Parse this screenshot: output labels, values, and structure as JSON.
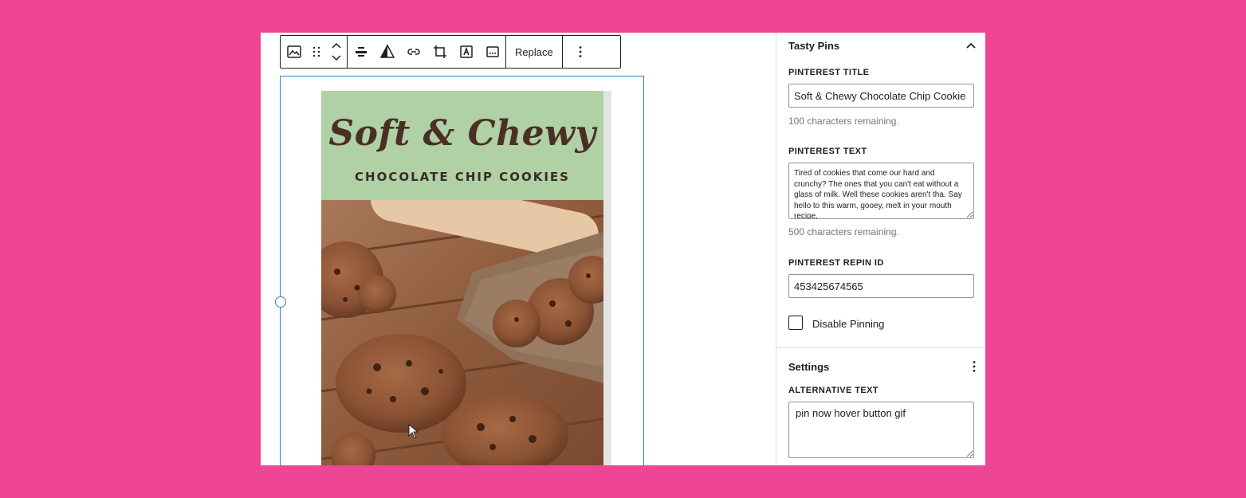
{
  "toolbar": {
    "replace_label": "Replace",
    "icons": [
      "image-icon",
      "drag-handle-icon",
      "move-up-icon",
      "move-down-icon",
      "align-icon",
      "duotone-icon",
      "link-icon",
      "crop-icon",
      "text-overlay-icon",
      "caption-icon",
      "more-options-icon"
    ]
  },
  "image": {
    "title_script": "Soft & Chewy",
    "subtitle": "CHOCOLATE CHIP COOKIES"
  },
  "sidebar": {
    "tasty_pins": {
      "heading": "Tasty Pins",
      "pinterest_title_label": "PINTEREST TITLE",
      "pinterest_title_value": "Soft & Chewy Chocolate Chip Cookie Recipe",
      "pinterest_title_help": "100 characters remaining.",
      "pinterest_text_label": "PINTEREST TEXT",
      "pinterest_text_value": "Tired of cookies that come our hard and crunchy? The ones that you can't eat without a glass of milk. Well these cookies aren't tha. Say hello to this warm, gooey, melt in your mouth recipe.",
      "pinterest_text_help": "500 characters remaining.",
      "repin_id_label": "PINTEREST REPIN ID",
      "repin_id_value": "453425674565",
      "disable_pinning_label": "Disable Pinning"
    },
    "settings": {
      "heading": "Settings",
      "alt_text_label": "ALTERNATIVE TEXT",
      "alt_text_value": "pin now hover button gif"
    }
  },
  "colors": {
    "background": "#ee4694",
    "arrow": "#1fcfc3",
    "selection": "#3582c4",
    "pin_header": "#b0d0a6"
  }
}
